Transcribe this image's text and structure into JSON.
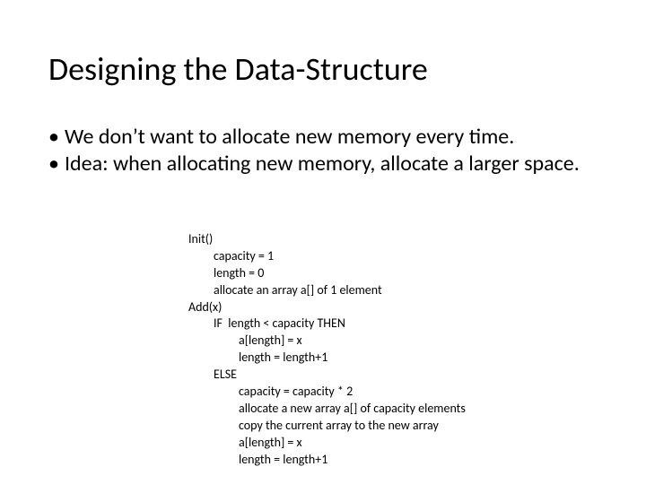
{
  "title": "Designing the Data-Structure",
  "bullets": [
    "We don’t want to allocate new memory every time.",
    "Idea: when allocating new memory, allocate a larger space."
  ],
  "pseudo": [
    {
      "indent": 0,
      "text": "Init()"
    },
    {
      "indent": 1,
      "text": "capacity = 1"
    },
    {
      "indent": 1,
      "text": "length = 0"
    },
    {
      "indent": 1,
      "text": "allocate an array a[] of 1 element"
    },
    {
      "indent": 0,
      "text": "Add(x)"
    },
    {
      "indent": 1,
      "text": "IF  length < capacity THEN"
    },
    {
      "indent": 2,
      "text": "a[length] = x"
    },
    {
      "indent": 2,
      "text": "length = length+1"
    },
    {
      "indent": 1,
      "text": "ELSE"
    },
    {
      "indent": 2,
      "text": "capacity = capacity * 2"
    },
    {
      "indent": 2,
      "text": "allocate a new array a[] of capacity elements"
    },
    {
      "indent": 2,
      "text": "copy the current array to the new array"
    },
    {
      "indent": 2,
      "text": "a[length] = x"
    },
    {
      "indent": 2,
      "text": "length = length+1"
    }
  ]
}
